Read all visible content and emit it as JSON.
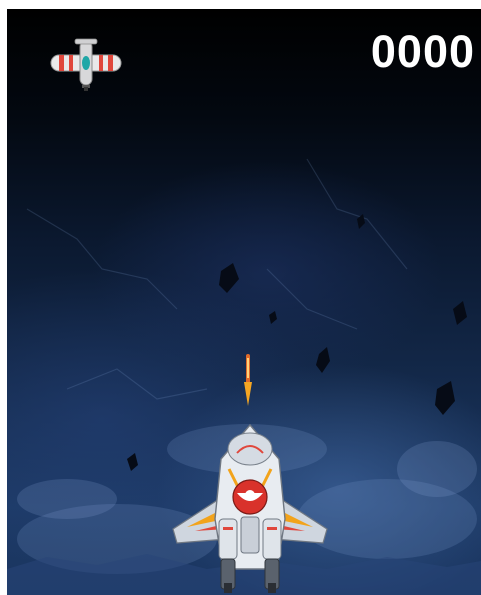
{
  "hud": {
    "score": "0000"
  },
  "icons": {
    "enemy": "propeller-plane-icon",
    "bullet": "bullet-icon",
    "player": "player-spaceship-icon"
  },
  "colors": {
    "score_text": "#ffffff",
    "bullet": "#f5a623",
    "enemy_stripe": "#e0473c"
  }
}
